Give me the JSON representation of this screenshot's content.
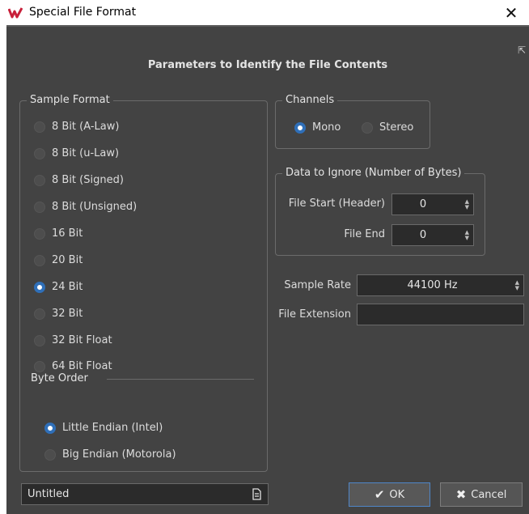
{
  "window": {
    "title": "Special File Format"
  },
  "heading": "Parameters to Identify the File Contents",
  "sample_format": {
    "legend": "Sample Format",
    "options": [
      {
        "label": "8 Bit (A-Law)",
        "checked": false
      },
      {
        "label": "8 Bit (u-Law)",
        "checked": false
      },
      {
        "label": "8 Bit (Signed)",
        "checked": false
      },
      {
        "label": "8 Bit (Unsigned)",
        "checked": false
      },
      {
        "label": "16 Bit",
        "checked": false
      },
      {
        "label": "20 Bit",
        "checked": false
      },
      {
        "label": "24 Bit",
        "checked": true
      },
      {
        "label": "32 Bit",
        "checked": false
      },
      {
        "label": "32 Bit Float",
        "checked": false
      },
      {
        "label": "64 Bit Float",
        "checked": false
      }
    ],
    "byte_order": {
      "legend": "Byte Order",
      "options": [
        {
          "label": "Little Endian (Intel)",
          "checked": true
        },
        {
          "label": "Big Endian (Motorola)",
          "checked": false
        }
      ]
    }
  },
  "channels": {
    "legend": "Channels",
    "options": [
      {
        "label": "Mono",
        "checked": true
      },
      {
        "label": "Stereo",
        "checked": false
      }
    ]
  },
  "ignore": {
    "legend": "Data to Ignore (Number of Bytes)",
    "file_start_label": "File Start (Header)",
    "file_start_value": "0",
    "file_end_label": "File End",
    "file_end_value": "0"
  },
  "sample_rate": {
    "label": "Sample Rate",
    "value": "44100 Hz"
  },
  "file_extension": {
    "label": "File Extension",
    "value": ""
  },
  "preset": {
    "value": "Untitled"
  },
  "buttons": {
    "ok": "OK",
    "cancel": "Cancel"
  },
  "colors": {
    "accent": "#2f6fb8",
    "background": "#434343",
    "field": "#2b2b2b"
  },
  "icons": {
    "app": "wavelab-logo-icon",
    "close": "close-icon",
    "preset": "preset-document-icon"
  }
}
